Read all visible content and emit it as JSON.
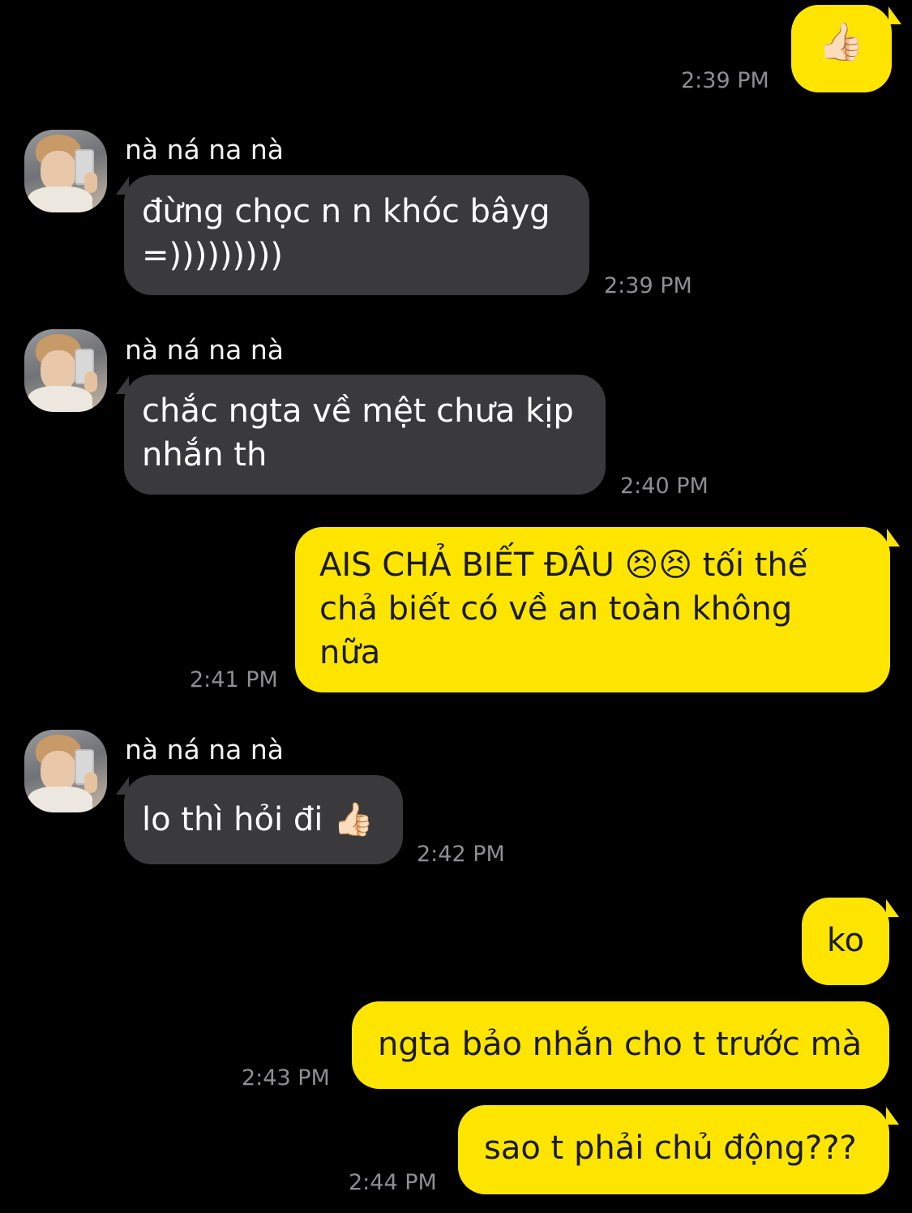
{
  "conversation": {
    "contact_name": "nà ná na nà",
    "messages": [
      {
        "from": "me",
        "text": "👍🏻",
        "time": "2:39 PM"
      },
      {
        "from": "contact",
        "text": "đừng chọc n n khóc bâyg =)))))))))",
        "line1": "đừng chọc n n khóc bâyg",
        "line2": "=)))))))))",
        "time": "2:39 PM"
      },
      {
        "from": "contact",
        "line1": "chắc ngta về mệt chưa kịp",
        "line2": "nhắn th",
        "time": "2:40 PM"
      },
      {
        "from": "me",
        "line1": "AIS CHẢ BIẾT ĐÂU 😣😣 tối thế",
        "line2": "chả biết có về an toàn không",
        "line3": "nữa",
        "time": "2:41 PM"
      },
      {
        "from": "contact",
        "text": "lo thì hỏi đi 👍🏻",
        "time": "2:42 PM"
      },
      {
        "from": "me",
        "text": "ko"
      },
      {
        "from": "me",
        "text": "ngta bảo nhắn cho t trước mà",
        "time": "2:43 PM"
      },
      {
        "from": "me",
        "text": "sao t phải chủ động???",
        "time": "2:44 PM"
      }
    ]
  },
  "colors": {
    "background": "#000000",
    "incoming_bubble": "#3a3a3c",
    "outgoing_bubble": "#fee500",
    "timestamp": "#8e8e93"
  },
  "icons": {
    "thumbs_up": "thumbs-up-emoji",
    "persevering_face": "persevering-face-emoji"
  }
}
